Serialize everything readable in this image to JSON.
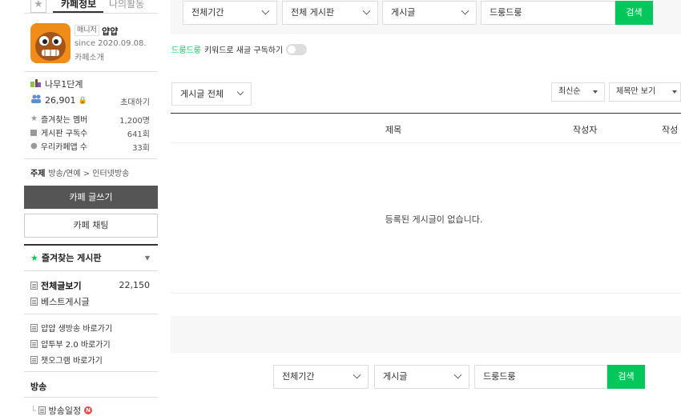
{
  "sidebar": {
    "tabs": {
      "cafe_info": "카페정보",
      "my_activity": "나의활동"
    },
    "profile": {
      "role": "매니저",
      "name": "얍얍",
      "since": "since 2020.09.08.",
      "intro": "카페소개"
    },
    "level": "나무1단계",
    "members": "26,901",
    "invite": "초대하기",
    "stats": [
      {
        "label": "즐겨찾는 멤버",
        "value": "1,200명"
      },
      {
        "label": "게시판 구독수",
        "value": "641회"
      },
      {
        "label": "우리카페앱 수",
        "value": "33회"
      }
    ],
    "topic": {
      "label": "주제",
      "value": "방송/연예 > 인터넷방송"
    },
    "write_button": "카페 글쓰기",
    "chat_button": "카페 채팅",
    "favorites_title": "즐겨찾는 게시판",
    "menu": {
      "all_posts": "전체글보기",
      "all_posts_count": "22,150",
      "best": "베스트게시글",
      "links": [
        "얍얍 생방송 바로가기",
        "얍투부 2.0 바로가기",
        "챗오그램 바로가기"
      ]
    },
    "section_broadcast": "방송",
    "broadcast_schedule": "방송일정",
    "new_badge": "N"
  },
  "search_top": {
    "period": "전체기간",
    "board": "전체 게시판",
    "type": "게시글",
    "query": "드룽드룽",
    "button": "검색"
  },
  "keyword_sub": {
    "keyword": "드룽드룽",
    "text": "키워드로 새글 구독하기"
  },
  "filter": {
    "all": "게시글 전체",
    "sort": "최신순",
    "view": "제목만 보기"
  },
  "table": {
    "columns": [
      "제목",
      "작성자",
      "작성"
    ],
    "empty": "등록된 게시글이 없습니다."
  },
  "search_bottom": {
    "period": "전체기간",
    "type": "게시글",
    "query": "드룽드룽",
    "button": "검색"
  },
  "colors": {
    "accent": "#03c75a",
    "dark_button": "#555555",
    "badge": "#e54b4b"
  }
}
